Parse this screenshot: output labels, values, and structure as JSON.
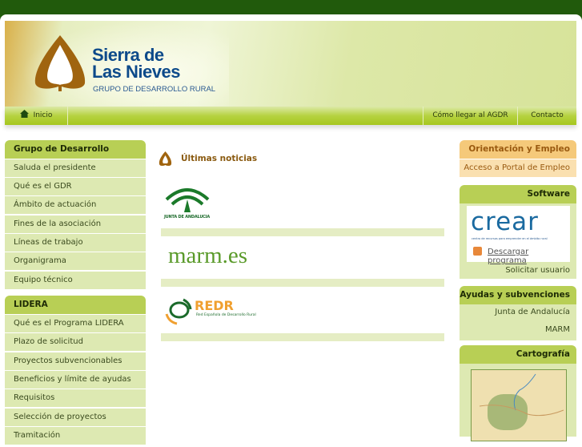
{
  "header": {
    "brand_line1": "Sierra de",
    "brand_line2": "Las Nieves",
    "subtitle": "GRUPO DE DESARROLLO RURAL"
  },
  "nav": {
    "items": [
      {
        "label": "Inicio",
        "icon": "home-icon"
      },
      {
        "label": "Cómo llegar al AGDR"
      },
      {
        "label": "Contacto"
      }
    ]
  },
  "left": {
    "sections": [
      {
        "title": "Grupo de Desarrollo",
        "items": [
          "Saluda el presidente",
          "Qué es el GDR",
          "Ámbito de actuación",
          "Fines de la asociación",
          "Líneas de trabajo",
          "Organigrama",
          "Equipo técnico"
        ]
      },
      {
        "title": "LIDERA",
        "items": [
          "Qué es el Programa LIDERA",
          "Plazo de solicitud",
          "Proyectos subvencionables",
          "Beneficios y límite de ayudas",
          "Requisitos",
          "Selección de proyectos",
          "Tramitación"
        ]
      }
    ]
  },
  "main": {
    "title": "Últimas noticias",
    "logos": [
      {
        "name": "Junta de Andalucía",
        "text": "JUNTA DE ANDALUCIA"
      },
      {
        "name": "marm.es",
        "text": "marm.es"
      },
      {
        "name": "REDR",
        "text": "REDR",
        "subtext": "Red Española de Desarrollo Rural"
      }
    ]
  },
  "right": {
    "empleo": {
      "title": "Orientación y Empleo",
      "link": "Acceso a Portal de Empleo"
    },
    "software": {
      "title": "Software",
      "logo": "crear",
      "logo_sub": "centro de recursos para emprender en el ámbito rural",
      "download": "Descargar programa",
      "request": "Solicitar usuario"
    },
    "ayudas": {
      "title": "Ayudas y subvenciones",
      "links": [
        "Junta de Andalucía",
        "MARM"
      ]
    },
    "cartografia": {
      "title": "Cartografía"
    }
  },
  "colors": {
    "top_bar": "#215a0c",
    "menu_header": "#b8cf55",
    "menu_item": "#dde9b2",
    "orange": "#f5c97a",
    "brand_blue": "#0d4a8a"
  }
}
